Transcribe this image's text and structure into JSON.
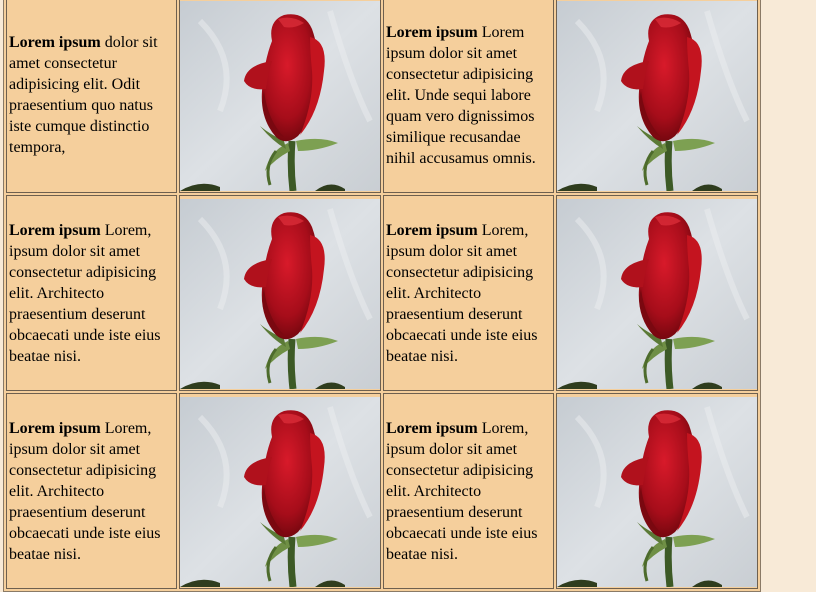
{
  "rows": [
    {
      "cells": [
        {
          "bold": "Lorem ipsum",
          "text": " dolor sit amet consectetur adipisicing elit. Odit praesentium quo natus iste cumque distinctio tempora,"
        },
        {
          "bold": "Lorem ipsum",
          "text": " Lorem ipsum dolor sit amet consectetur adipisicing elit. Unde sequi labore quam vero dignissimos similique recusandae nihil accusamus omnis."
        }
      ]
    },
    {
      "cells": [
        {
          "bold": "Lorem ipsum",
          "text": " Lorem, ipsum dolor sit amet consectetur adipisicing elit. Architecto praesentium deserunt obcaecati unde iste eius beatae nisi."
        },
        {
          "bold": "Lorem ipsum",
          "text": " Lorem, ipsum dolor sit amet consectetur adipisicing elit. Architecto praesentium deserunt obcaecati unde iste eius beatae nisi."
        }
      ]
    },
    {
      "cells": [
        {
          "bold": "Lorem ipsum",
          "text": " Lorem, ipsum dolor sit amet consectetur adipisicing elit. Architecto praesentium deserunt obcaecati unde iste eius beatae nisi."
        },
        {
          "bold": "Lorem ipsum",
          "text": " Lorem, ipsum dolor sit amet consectetur adipisicing elit. Architecto praesentium deserunt obcaecati unde iste eius beatae nisi."
        }
      ]
    }
  ],
  "image": {
    "subject": "red-rose-icon"
  },
  "colors": {
    "page_background": "#f8ead7",
    "cell_background": "#f5cf9c",
    "rose_red": "#b01020"
  }
}
